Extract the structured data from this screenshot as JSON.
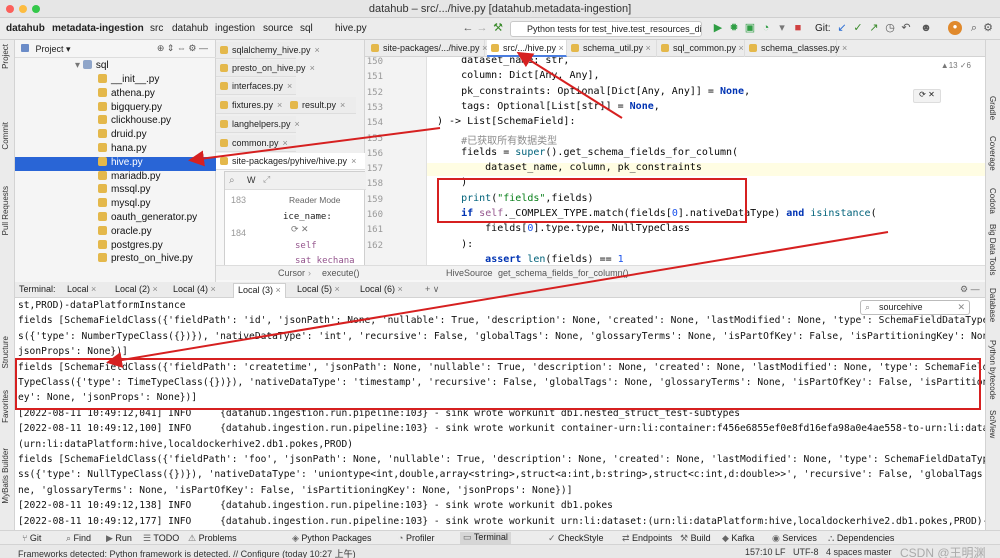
{
  "window": {
    "title": "datahub – src/.../hive.py [datahub.metadata-ingestion]"
  },
  "navbar": {
    "breadcrumbs": [
      "datahub",
      "metadata-ingestion",
      "src",
      "datahub",
      "ingestion",
      "source",
      "sql",
      "hive.py"
    ],
    "run_config": "Python tests for test_hive.test_resources_dir",
    "git_label": "Git:"
  },
  "project_panel": {
    "header": "Project",
    "folder": "sql",
    "files": [
      "__init__.py",
      "athena.py",
      "bigquery.py",
      "clickhouse.py",
      "druid.py",
      "hana.py",
      "hive.py",
      "mariadb.py",
      "mssql.py",
      "mysql.py",
      "oauth_generator.py",
      "oracle.py",
      "postgres.py",
      "presto_on_hive.py"
    ],
    "selected": "hive.py"
  },
  "left_tabs": [
    "sqlalchemy_hive.py",
    "presto_on_hive.py",
    "interfaces.py",
    "fixtures.py",
    "result.py",
    "langhelpers.py",
    "common.py",
    "site-packages/pyhive/hive.py"
  ],
  "right_tabs": [
    "site-packages/.../hive.py",
    "src/.../hive.py",
    "schema_util.py",
    "sql_common.py",
    "schema_classes.py"
  ],
  "editor": {
    "line_numbers": [
      "150",
      "151",
      "152",
      "153",
      "154",
      "155",
      "156",
      "157",
      "158",
      "159",
      "160",
      "161",
      "162"
    ],
    "inspection": "▲13 ✓6",
    "lines": [
      "    dataset_name: str,",
      "    column: Dict[Any, Any],",
      "    pk_constraints: Optional[Dict[Any, Any]] = None,",
      "    tags: Optional[List[str]] = None,",
      ") -> List[SchemaField]:",
      "    #已获取所有数据类型",
      "    fields = super().get_schema_fields_for_column(",
      "        dataset_name, column, pk_constraints",
      "    )",
      "    print(\"fields\",fields)",
      "    if self._COMPLEX_TYPE.match(fields[0].nativeDataType) and isinstance(",
      "        fields[0].type.type, NullTypeClass",
      "    ):",
      "        assert len(fields) == 1"
    ]
  },
  "popup": {
    "reader_mode": "Reader Mode",
    "line_numbers": [
      "183",
      "184"
    ],
    "code": [
      "ice_name:",
      "self",
      "sat kechana"
    ],
    "search_letter": "W"
  },
  "editor_breadcrumb": {
    "left": [
      "Cursor",
      "execute()"
    ],
    "right": [
      "HiveSource",
      "get_schema_fields_for_column()"
    ]
  },
  "terminal": {
    "label": "Terminal:",
    "tabs": [
      "Local",
      "Local (2)",
      "Local (4)",
      "Local (3)",
      "Local (5)",
      "Local (6)"
    ],
    "active_tab": "Local (3)",
    "search": "sourcehive",
    "lines": [
      "st,PROD)-dataPlatformInstance",
      "fields [SchemaFieldClass({'fieldPath': 'id', 'jsonPath': None, 'nullable': True, 'description': None, 'created': None, 'lastModified': None, 'type': SchemaFieldDataTypeClas",
      "s({'type': NumberTypeClass({})}), 'nativeDataType': 'int', 'recursive': False, 'globalTags': None, 'glossaryTerms': None, 'isPartOfKey': False, 'isPartitioningKey': None, '",
      "jsonProps': None})]",
      "fields [SchemaFieldClass({'fieldPath': 'createtime', 'jsonPath': None, 'nullable': True, 'description': None, 'created': None, 'lastModified': None, 'type': SchemaFieldData",
      "TypeClass({'type': TimeTypeClass({})}), 'nativeDataType': 'timestamp', 'recursive': False, 'globalTags': None, 'glossaryTerms': None, 'isPartOfKey': False, 'isPartitioningK",
      "ey': None, 'jsonProps': None})]",
      "[2022-08-11 10:49:12,041] INFO     {datahub.ingestion.run.pipeline:103} - sink wrote workunit db1.nested_struct_test-subtypes",
      "[2022-08-11 10:49:12,100] INFO     {datahub.ingestion.run.pipeline:103} - sink wrote workunit container-urn:li:container:f456e6855ef0e8fd16efa98a0e4ae558-to-urn:li:dataset:",
      "(urn:li:dataPlatform:hive,localdockerhive2.db1.pokes,PROD)",
      "fields [SchemaFieldClass({'fieldPath': 'foo', 'jsonPath': None, 'nullable': True, 'description': None, 'created': None, 'lastModified': None, 'type': SchemaFieldDataTypeCla",
      "ss({'type': NullTypeClass({})}), 'nativeDataType': 'uniontype<int,double,array<string>,struct<a:int,b:string>,struct<c:int,d:double>>', 'recursive': False, 'globalTags': No",
      "ne, 'glossaryTerms': None, 'isPartOfKey': False, 'isPartitioningKey': None, 'jsonProps': None})]",
      "[2022-08-11 10:49:12,138] INFO     {datahub.ingestion.run.pipeline:103} - sink wrote workunit db1.pokes",
      "[2022-08-11 10:49:12,177] INFO     {datahub.ingestion.run.pipeline:103} - sink wrote workunit urn:li:dataset:(urn:li:dataPlatform:hive,localdockerhive2.db1.pokes,PROD)-data"
    ]
  },
  "bottom_tools": [
    "Git",
    "Find",
    "Run",
    "TODO",
    "Problems",
    "Python Packages",
    "Profiler",
    "Terminal",
    "CheckStyle",
    "Endpoints",
    "Build",
    "Kafka",
    "Services",
    "Dependencies"
  ],
  "bottom_active": "Terminal",
  "left_strip": [
    "Project",
    "Commit",
    "Pull Requests",
    "Structure",
    "Favorites",
    "MyBatis Builder"
  ],
  "right_strip": [
    "Gradle",
    "Coverage",
    "Codota",
    "Big Data Tools",
    "Database",
    "Python bytecode",
    "SciView"
  ],
  "status": {
    "message": "Frameworks detected: Python framework is detected. // Configure (today 10:27 上午)",
    "position": "157:10",
    "line_sep": "LF",
    "encoding": "UTF-8",
    "indent": "4 spaces",
    "branch": "master",
    "watermark": "CSDN @王明渊"
  },
  "colors": {
    "annotation_red": "#d62020",
    "selection_blue": "#2965d6"
  }
}
